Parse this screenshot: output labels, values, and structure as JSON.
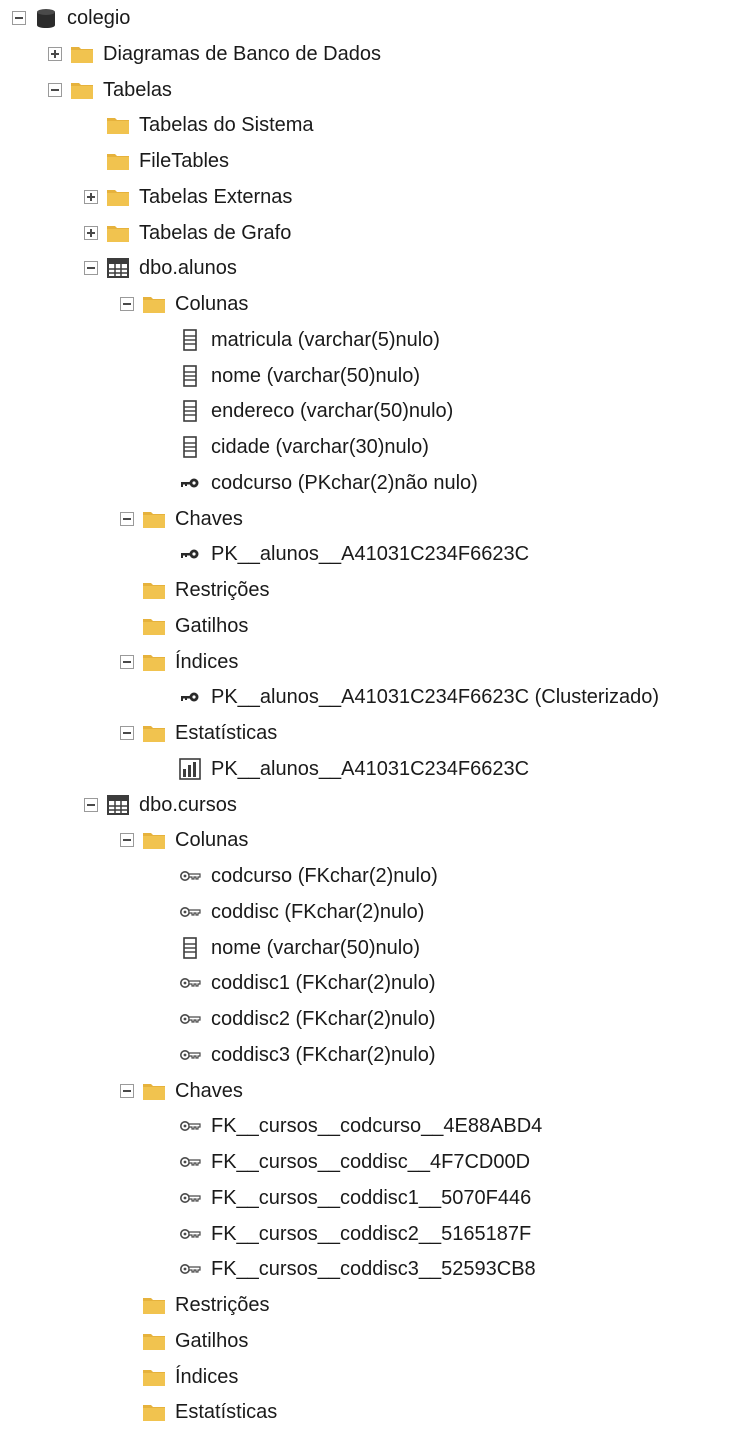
{
  "tree": {
    "nodes": [
      {
        "label": "colegio",
        "icon": "database-icon",
        "expander": "expanded"
      },
      {
        "label": "Diagramas de Banco de Dados",
        "icon": "folder-icon",
        "expander": "collapsed"
      },
      {
        "label": "Tabelas",
        "icon": "folder-icon",
        "expander": "expanded"
      },
      {
        "label": "Tabelas do Sistema",
        "icon": "folder-icon",
        "expander": "none"
      },
      {
        "label": "FileTables",
        "icon": "folder-icon",
        "expander": "none"
      },
      {
        "label": "Tabelas Externas",
        "icon": "folder-icon",
        "expander": "collapsed"
      },
      {
        "label": "Tabelas de Grafo",
        "icon": "folder-icon",
        "expander": "collapsed"
      },
      {
        "label": "dbo.alunos",
        "icon": "table-icon",
        "expander": "expanded"
      },
      {
        "label": "Colunas",
        "icon": "folder-icon",
        "expander": "expanded"
      },
      {
        "label": "matricula (varchar(5)nulo)",
        "icon": "column-icon",
        "expander": "none"
      },
      {
        "label": "nome (varchar(50)nulo)",
        "icon": "column-icon",
        "expander": "none"
      },
      {
        "label": "endereco (varchar(50)nulo)",
        "icon": "column-icon",
        "expander": "none"
      },
      {
        "label": "cidade (varchar(30)nulo)",
        "icon": "column-icon",
        "expander": "none"
      },
      {
        "label": "codcurso (PKchar(2)não nulo)",
        "icon": "primary-key-icon",
        "expander": "none"
      },
      {
        "label": "Chaves",
        "icon": "folder-icon",
        "expander": "expanded"
      },
      {
        "label": "PK__alunos__A41031C234F6623C",
        "icon": "primary-key-icon",
        "expander": "none"
      },
      {
        "label": "Restrições",
        "icon": "folder-icon",
        "expander": "none"
      },
      {
        "label": "Gatilhos",
        "icon": "folder-icon",
        "expander": "none"
      },
      {
        "label": "Índices",
        "icon": "folder-icon",
        "expander": "expanded"
      },
      {
        "label": "PK__alunos__A41031C234F6623C (Clusterizado)",
        "icon": "primary-key-icon",
        "expander": "none"
      },
      {
        "label": "Estatísticas",
        "icon": "folder-icon",
        "expander": "expanded"
      },
      {
        "label": "PK__alunos__A41031C234F6623C",
        "icon": "statistics-icon",
        "expander": "none"
      },
      {
        "label": "dbo.cursos",
        "icon": "table-icon",
        "expander": "expanded"
      },
      {
        "label": "Colunas",
        "icon": "folder-icon",
        "expander": "expanded"
      },
      {
        "label": "codcurso (FKchar(2)nulo)",
        "icon": "foreign-key-icon",
        "expander": "none"
      },
      {
        "label": "coddisc (FKchar(2)nulo)",
        "icon": "foreign-key-icon",
        "expander": "none"
      },
      {
        "label": "nome (varchar(50)nulo)",
        "icon": "column-icon",
        "expander": "none"
      },
      {
        "label": "coddisc1 (FKchar(2)nulo)",
        "icon": "foreign-key-icon",
        "expander": "none"
      },
      {
        "label": "coddisc2 (FKchar(2)nulo)",
        "icon": "foreign-key-icon",
        "expander": "none"
      },
      {
        "label": "coddisc3 (FKchar(2)nulo)",
        "icon": "foreign-key-icon",
        "expander": "none"
      },
      {
        "label": "Chaves",
        "icon": "folder-icon",
        "expander": "expanded"
      },
      {
        "label": "FK__cursos__codcurso__4E88ABD4",
        "icon": "foreign-key-icon",
        "expander": "none"
      },
      {
        "label": "FK__cursos__coddisc__4F7CD00D",
        "icon": "foreign-key-icon",
        "expander": "none"
      },
      {
        "label": "FK__cursos__coddisc1__5070F446",
        "icon": "foreign-key-icon",
        "expander": "none"
      },
      {
        "label": "FK__cursos__coddisc2__5165187F",
        "icon": "foreign-key-icon",
        "expander": "none"
      },
      {
        "label": "FK__cursos__coddisc3__52593CB8",
        "icon": "foreign-key-icon",
        "expander": "none"
      },
      {
        "label": "Restrições",
        "icon": "folder-icon",
        "expander": "none"
      },
      {
        "label": "Gatilhos",
        "icon": "folder-icon",
        "expander": "none"
      },
      {
        "label": "Índices",
        "icon": "folder-icon",
        "expander": "none"
      },
      {
        "label": "Estatísticas",
        "icon": "folder-icon",
        "expander": "none"
      }
    ]
  },
  "colors": {
    "folder": "#f1c34f",
    "folder_tab": "#e6b23c",
    "text": "#1a1a1a",
    "icon_dark": "#3c3c3c"
  }
}
